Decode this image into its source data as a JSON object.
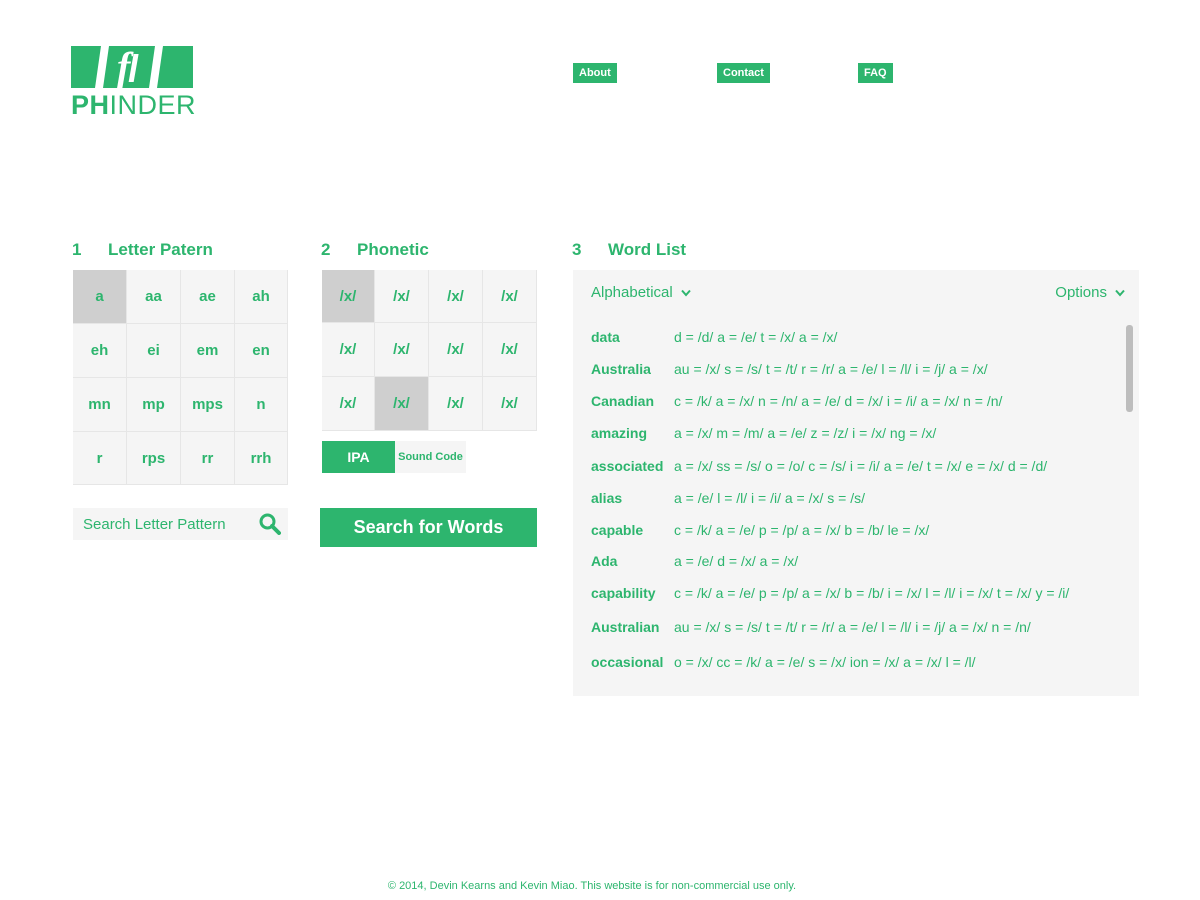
{
  "brand": {
    "name_bold": "PH",
    "name_rest": "INDER",
    "accent": "#2db56e"
  },
  "nav": {
    "about": "About",
    "contact": "Contact",
    "faq": "FAQ"
  },
  "sections": {
    "letter": {
      "num": "1",
      "title": "Letter Patern"
    },
    "phonetic": {
      "num": "2",
      "title": "Phonetic"
    },
    "words": {
      "num": "3",
      "title": "Word List"
    }
  },
  "letter_patterns": [
    "a",
    "aa",
    "ae",
    "ah",
    "eh",
    "ei",
    "em",
    "en",
    "mn",
    "mp",
    "mps",
    "n",
    "r",
    "rps",
    "rr",
    "rrh"
  ],
  "letter_selected": "a",
  "phonetics": [
    "/x/",
    "/x/",
    "/x/",
    "/x/",
    "/x/",
    "/x/",
    "/x/",
    "/x/",
    "/x/",
    "/x/",
    "/x/",
    "/x/"
  ],
  "search_letter": {
    "placeholder": "Search Letter Pattern",
    "icon": "search-icon"
  },
  "toggle": {
    "ipa": "IPA",
    "sound_code": "Sound Code"
  },
  "search_button": "Search for Words",
  "word_list": {
    "sort": "Alphabetical",
    "options": "Options",
    "rows": [
      {
        "word": "data",
        "map": "d = /d/ a = /e/ t = /x/ a = /x/"
      },
      {
        "word": "Australia",
        "map": "au = /x/ s = /s/ t = /t/ r = /r/ a = /e/ l = /l/ i = /j/ a = /x/"
      },
      {
        "word": "Canadian",
        "map": "c = /k/ a = /x/ n = /n/ a = /e/ d = /x/ i = /i/ a = /x/ n = /n/"
      },
      {
        "word": "amazing",
        "map": "a = /x/ m = /m/ a = /e/ z = /z/ i = /x/ ng = /x/"
      },
      {
        "word": "associated",
        "map": "a = /x/ ss = /s/ o = /o/ c = /s/ i = /i/ a = /e/ t = /x/ e = /x/ d = /d/"
      },
      {
        "word": "alias",
        "map": "a = /e/ l = /l/ i = /i/ a = /x/ s = /s/"
      },
      {
        "word": "capable",
        "map": "c = /k/ a = /e/ p = /p/ a = /x/ b = /b/ le = /x/"
      },
      {
        "word": "Ada",
        "map": "a = /e/ d = /x/ a = /x/"
      },
      {
        "word": "capability",
        "map": "c = /k/ a = /e/ p = /p/ a = /x/ b = /b/ i = /x/ l = /l/ i = /x/ t = /x/ y = /i/"
      },
      {
        "word": "Australian",
        "map": "au = /x/ s = /s/ t = /t/ r = /r/ a = /e/ l = /l/ i = /j/ a = /x/ n = /n/"
      },
      {
        "word": "occasional",
        "map": "o = /x/ cc = /k/ a = /e/ s = /x/ ion = /x/ a = /x/ l = /l/"
      }
    ]
  },
  "footer": "© 2014, Devin Kearns and Kevin Miao. This website is for non-commercial use only."
}
